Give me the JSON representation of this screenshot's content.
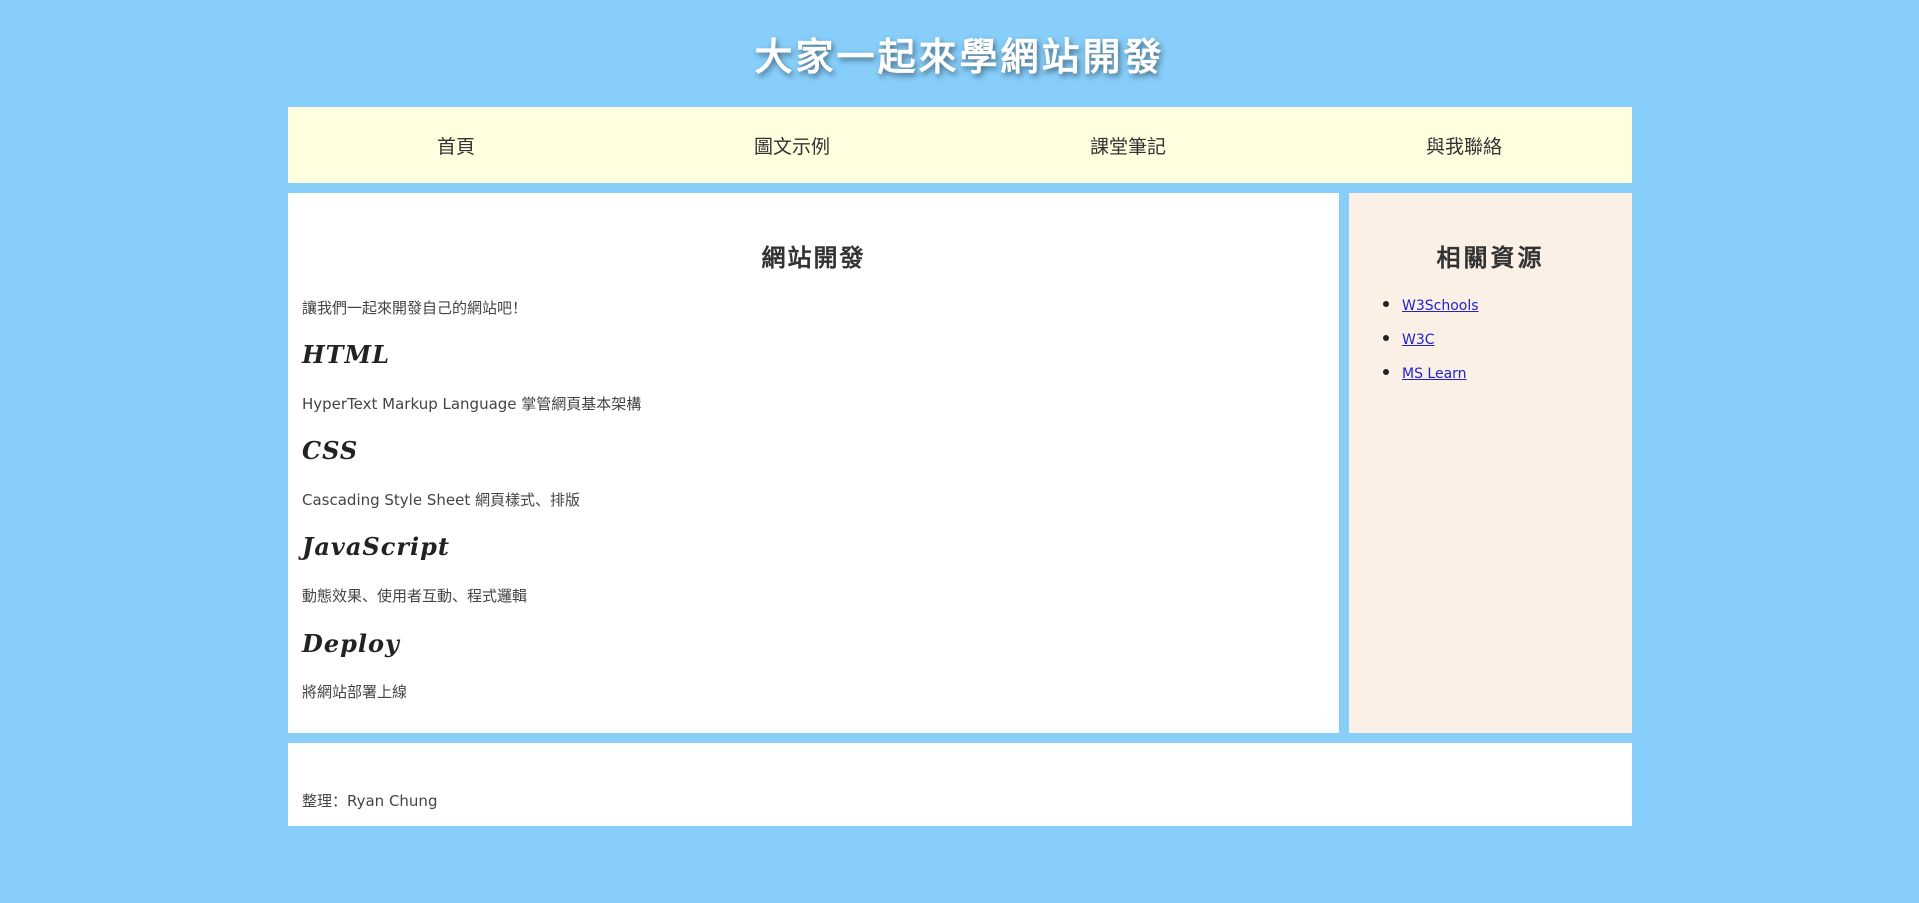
{
  "site_title": "大家一起來學網站開發",
  "nav": {
    "items": [
      {
        "label": "首頁"
      },
      {
        "label": "圖文示例"
      },
      {
        "label": "課堂筆記"
      },
      {
        "label": "與我聯絡"
      }
    ]
  },
  "main": {
    "heading": "網站開發",
    "intro": "讓我們一起來開發自己的網站吧！",
    "topics": [
      {
        "title": "HTML",
        "desc": "HyperText Markup Language 掌管網頁基本架構"
      },
      {
        "title": "CSS",
        "desc": "Cascading Style Sheet 網頁樣式、排版"
      },
      {
        "title": "JavaScript",
        "desc": "動態效果、使用者互動、程式邏輯"
      },
      {
        "title": "Deploy",
        "desc": "將網站部署上線"
      }
    ]
  },
  "aside": {
    "heading": "相關資源",
    "links": [
      {
        "label": "W3Schools"
      },
      {
        "label": "W3C"
      },
      {
        "label": "MS Learn"
      }
    ]
  },
  "footer": {
    "text": "整理：Ryan Chung"
  },
  "colors": {
    "page_background": "#87cefa",
    "nav_background": "#ffffe0",
    "aside_background": "#faf0e6",
    "content_background": "#ffffff",
    "link": "#2222cc"
  }
}
